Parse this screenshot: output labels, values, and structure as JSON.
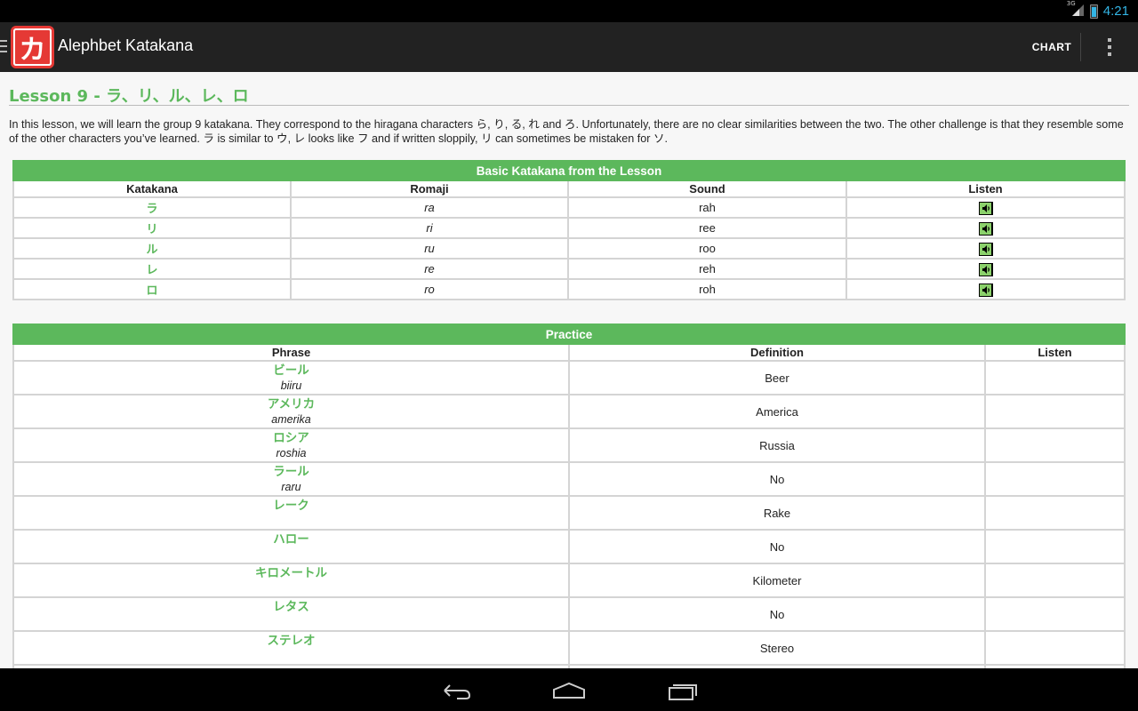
{
  "status": {
    "network": "3G",
    "time": "4:21"
  },
  "app": {
    "icon_glyph": "カ",
    "title": "Alephbet Katakana",
    "chart_label": "CHART"
  },
  "lesson": {
    "title": "Lesson 9 - ラ、リ、ル、レ、ロ",
    "intro": "In this lesson, we will learn the group 9 katakana. They correspond to the hiragana characters ら, り, る, れ and ろ. Unfortunately, there are no clear similarities between the two. The other challenge is that they resemble some of the other characters you’ve learned. ラ is similar to ウ, レ looks like フ and if written sloppily, リ can sometimes be mistaken for ソ."
  },
  "basic_table": {
    "caption": "Basic Katakana from the Lesson",
    "headers": [
      "Katakana",
      "Romaji",
      "Sound",
      "Listen"
    ],
    "rows": [
      {
        "kana": "ラ",
        "romaji": "ra",
        "sound": "rah"
      },
      {
        "kana": "リ",
        "romaji": "ri",
        "sound": "ree"
      },
      {
        "kana": "ル",
        "romaji": "ru",
        "sound": "roo"
      },
      {
        "kana": "レ",
        "romaji": "re",
        "sound": "reh"
      },
      {
        "kana": "ロ",
        "romaji": "ro",
        "sound": "roh"
      }
    ]
  },
  "practice_table": {
    "caption": "Practice",
    "headers": [
      "Phrase",
      "Definition",
      "Listen"
    ],
    "rows": [
      {
        "kana": "ビール",
        "romaji": "biiru",
        "definition": "Beer"
      },
      {
        "kana": "アメリカ",
        "romaji": "amerika",
        "definition": "America"
      },
      {
        "kana": "ロシア",
        "romaji": "roshia",
        "definition": "Russia"
      },
      {
        "kana": "ラール",
        "romaji": "raru",
        "definition": "No"
      },
      {
        "kana": "レーク",
        "romaji": "",
        "definition": "Rake"
      },
      {
        "kana": "ハロー",
        "romaji": "",
        "definition": "No"
      },
      {
        "kana": "キロメートル",
        "romaji": "",
        "definition": "Kilometer"
      },
      {
        "kana": "レタス",
        "romaji": "",
        "definition": "No"
      },
      {
        "kana": "ステレオ",
        "romaji": "",
        "definition": "Stereo"
      }
    ]
  },
  "icons": {
    "speaker": "speaker-icon",
    "back": "back-icon",
    "home": "home-icon",
    "recents": "recent-apps-icon"
  },
  "colors": {
    "accent_green": "#5cb85c",
    "action_bar": "#222222",
    "clock_blue": "#33b5e5",
    "icon_red": "#e53935"
  }
}
